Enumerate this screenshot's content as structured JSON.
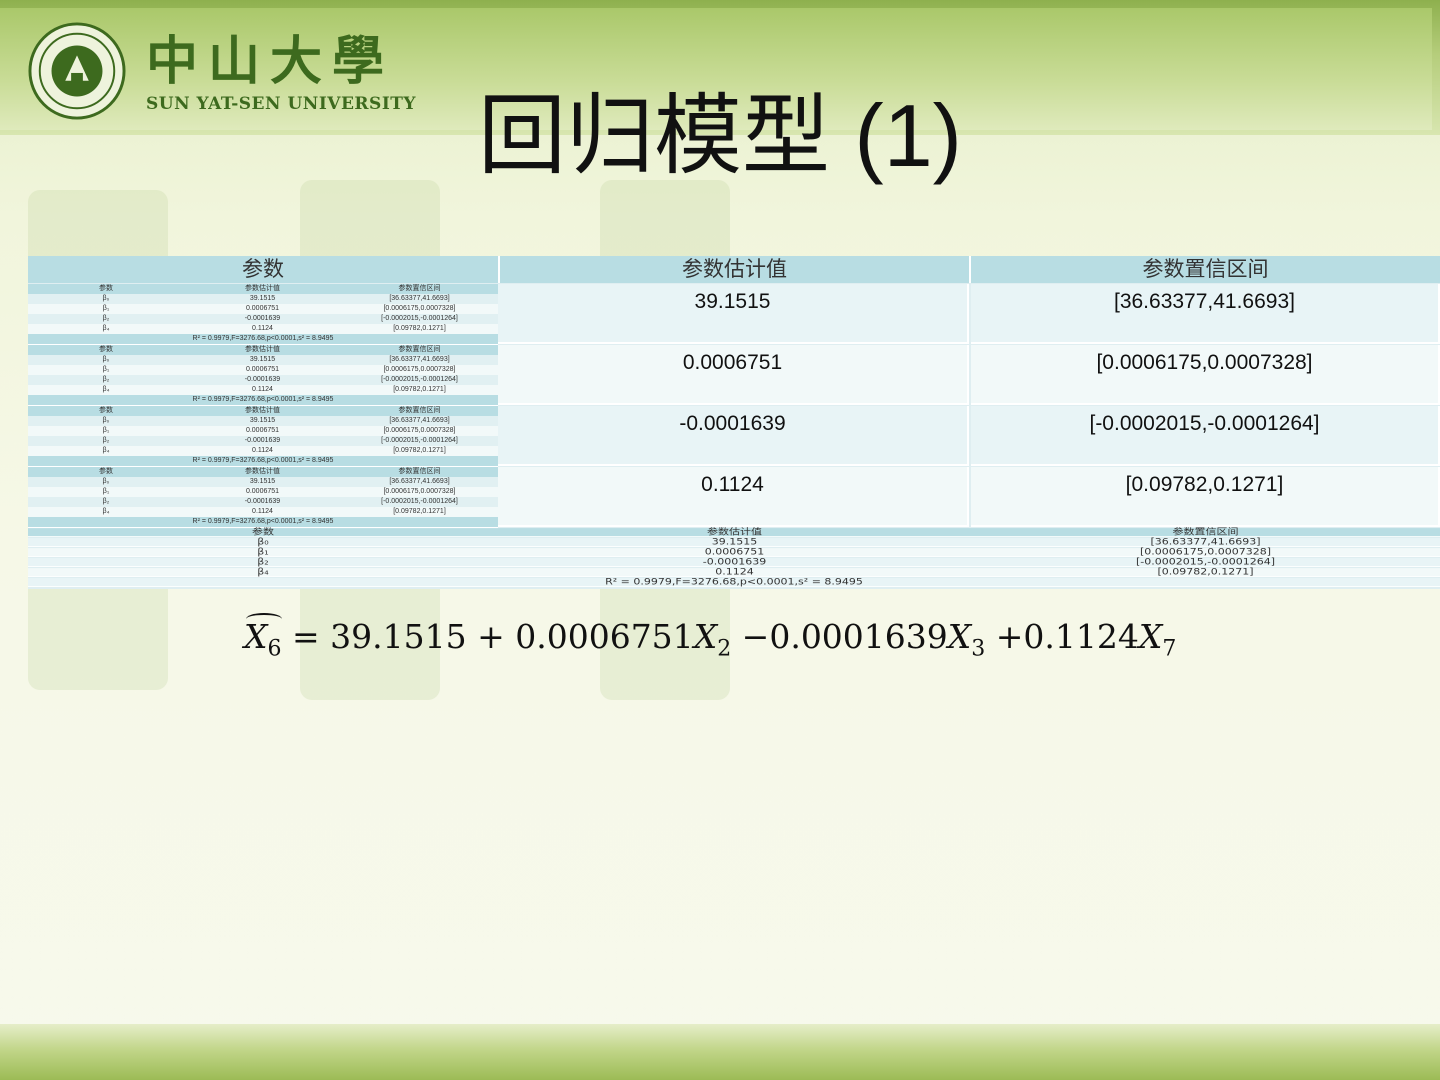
{
  "header": {
    "logo_cn": "中山大學",
    "logo_en": "SUN YAT-SEN UNIVERSITY",
    "seal_text": "中山大学 SUN YAT-SEN UNIVERSITY"
  },
  "slide": {
    "title": "回归模型 (1)"
  },
  "table": {
    "headers": [
      "参数",
      "参数估计值",
      "参数置信区间"
    ],
    "rows": [
      {
        "estimate": "39.1515",
        "interval": "[36.63377,41.6693]"
      },
      {
        "estimate": "0.0006751",
        "interval": "[0.0006175,0.0007328]"
      },
      {
        "estimate": "-0.0001639",
        "interval": "[-0.0002015,-0.0001264]"
      },
      {
        "estimate": "0.1124",
        "interval": "[0.09782,0.1271]"
      }
    ],
    "mini_table": {
      "headers": [
        "参数",
        "参数估计值",
        "参数置信区间"
      ],
      "params": [
        "β₀",
        "β₁",
        "β₂",
        "β₄"
      ],
      "estimates": [
        "39.1515",
        "0.0006751",
        "-0.0001639",
        "0.1124"
      ],
      "intervals": [
        "[36.63377,41.6693]",
        "[0.0006175,0.0007328]",
        "[-0.0002015,-0.0001264]",
        "[0.09782,0.1271]"
      ],
      "stats": "R² = 0.9979,F=3276.68,p<0.0001,s² = 8.9495"
    }
  },
  "formula": {
    "lhs_var": "X",
    "lhs_sub": "6",
    "eq": " = 39.1515 + 0.0006751",
    "x2": "X",
    "x2_sub": "2",
    "t2": " −0.0001639",
    "x3": "X",
    "x3_sub": "3",
    "t3": " +0.1124",
    "x7": "X",
    "x7_sub": "7"
  }
}
